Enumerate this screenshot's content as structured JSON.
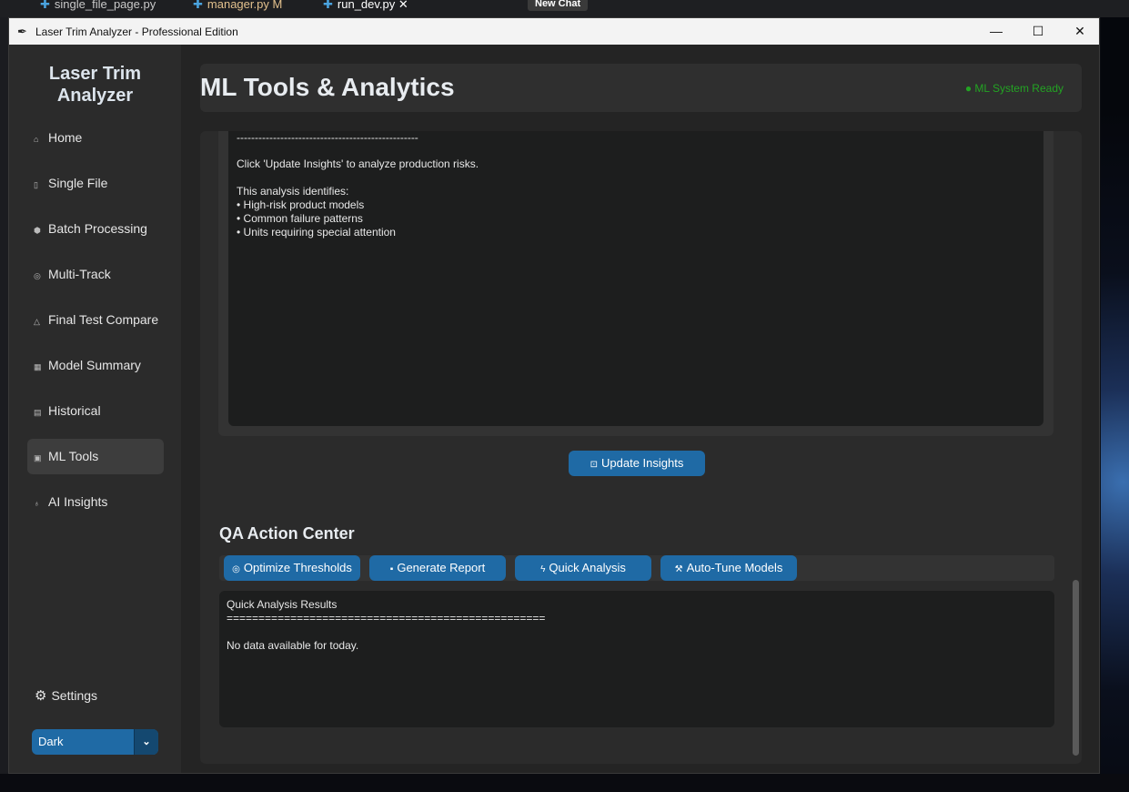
{
  "background": {
    "tabs": [
      {
        "label": "single_file_page.py"
      },
      {
        "label": "manager.py",
        "badge": "M"
      },
      {
        "label": "run_dev.py"
      }
    ],
    "new_chat": "New Chat"
  },
  "window": {
    "title": "Laser Trim Analyzer - Professional Edition",
    "controls": {
      "minimize": "—",
      "maximize": "☐",
      "close": "✕"
    }
  },
  "sidebar": {
    "logo_line1": "Laser Trim",
    "logo_line2": "Analyzer",
    "items": [
      {
        "label": "Home",
        "icon": "home-icon"
      },
      {
        "label": "Single File",
        "icon": "file-icon"
      },
      {
        "label": "Batch Processing",
        "icon": "package-icon"
      },
      {
        "label": "Multi-Track",
        "icon": "target-icon"
      },
      {
        "label": "Final Test Compare",
        "icon": "flask-icon"
      },
      {
        "label": "Model Summary",
        "icon": "chart-icon"
      },
      {
        "label": "Historical",
        "icon": "scroll-icon"
      },
      {
        "label": "ML Tools",
        "icon": "robot-icon",
        "active": true
      },
      {
        "label": "AI Insights",
        "icon": "bulb-icon"
      }
    ],
    "settings_label": "Settings",
    "theme_value": "Dark"
  },
  "header": {
    "title": "ML Tools & Analytics",
    "status": "● ML System Ready",
    "status_color": "#23a423"
  },
  "insights": {
    "lines": [
      "--------------------------------------------------",
      "",
      "Click 'Update Insights' to analyze production risks.",
      "",
      "This analysis identifies:",
      "• High-risk product models",
      "• Common failure patterns",
      "• Units requiring special attention"
    ],
    "update_button": "Update Insights"
  },
  "qa": {
    "title": "QA Action Center",
    "buttons": [
      {
        "label": "Optimize Thresholds",
        "icon": "target-icon"
      },
      {
        "label": "Generate Report",
        "icon": "save-icon"
      },
      {
        "label": "Quick Analysis",
        "icon": "lightning-icon"
      },
      {
        "label": "Auto-Tune Models",
        "icon": "wrench-icon"
      }
    ],
    "results": {
      "heading": "Quick Analysis Results",
      "divider": "==================================================",
      "message": "No data available for today."
    }
  },
  "colors": {
    "accent": "#1f6aa5",
    "sidebar_bg": "#2b2b2b",
    "panel_bg": "#1d1e1e"
  }
}
